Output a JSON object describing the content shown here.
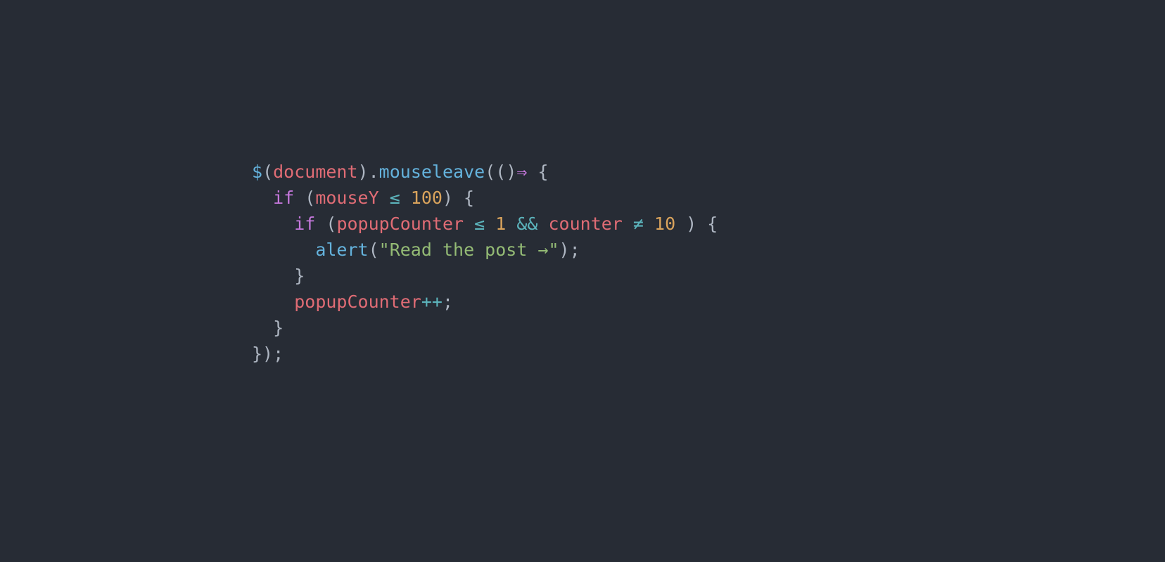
{
  "code": {
    "dollar": "$",
    "lparen": "(",
    "rparen": ")",
    "document": "document",
    "dot": ".",
    "mouseleave": "mouseleave",
    "arrow": "⇒",
    "lbrace": " {",
    "if1_kw": "if",
    "if1_open": " (",
    "mouseY": "mouseY",
    "le": " ≤ ",
    "n100": "100",
    "if1_close": ") {",
    "if2_kw": "if",
    "if2_open": " (",
    "popupCounter": "popupCounter",
    "n1": "1",
    "andop": " && ",
    "counter": "counter",
    "ne": " ≠ ",
    "n10": "10",
    "if2_close": " ) {",
    "alert": "alert",
    "alert_open": "(",
    "string": "\"Read the post →\"",
    "alert_close": ");",
    "close_if2": "}",
    "popupCounter2": "popupCounter",
    "inc": "++",
    "semi": ";",
    "close_if1": "}",
    "close_fn": "});",
    "indent": "  ",
    "guide": "  "
  }
}
